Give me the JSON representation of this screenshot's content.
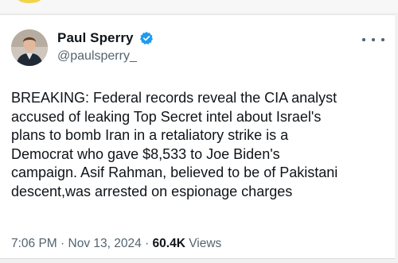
{
  "tweet": {
    "author_name": "Paul Sperry",
    "handle": "@paulsperry_",
    "text": "BREAKING: Federal records reveal the CIA analyst\naccused of leaking Top Secret intel about Israel's\nplans to bomb Iran in a retaliatory strike is a\nDemocrat who gave $8,533 to Joe Biden's\ncampaign. Asif Rahman, believed to be of Pakistani\ndescent,was arrested on espionage charges",
    "time": "7:06 PM",
    "separator": "·",
    "date": "Nov 13, 2024",
    "views_count": "60.4K",
    "views_label": "Views"
  },
  "icons": {
    "avatar": "profile-photo",
    "verified": "verified-badge-icon",
    "more": "more-options-icon"
  },
  "colors": {
    "primary_text": "#0f1419",
    "secondary_text": "#536471",
    "verified_blue": "#1d9bf0",
    "card_background": "#ffffff",
    "page_background": "#f1f1f1"
  }
}
